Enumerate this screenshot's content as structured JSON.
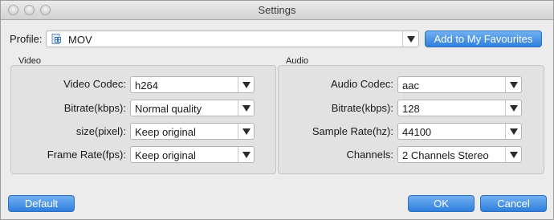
{
  "window": {
    "title": "Settings"
  },
  "profile": {
    "label": "Profile:",
    "value": "MOV",
    "favourites_label": "Add to My Favourites"
  },
  "video": {
    "title": "Video",
    "rows": [
      {
        "label": "Video Codec:",
        "value": "h264"
      },
      {
        "label": "Bitrate(kbps):",
        "value": "Normal quality"
      },
      {
        "label": "size(pixel):",
        "value": "Keep original"
      },
      {
        "label": "Frame Rate(fps):",
        "value": "Keep original"
      }
    ]
  },
  "audio": {
    "title": "Audio",
    "rows": [
      {
        "label": "Audio Codec:",
        "value": "aac"
      },
      {
        "label": "Bitrate(kbps):",
        "value": "128"
      },
      {
        "label": "Sample Rate(hz):",
        "value": "44100"
      },
      {
        "label": "Channels:",
        "value": "2 Channels Stereo"
      }
    ]
  },
  "buttons": {
    "default": "Default",
    "ok": "OK",
    "cancel": "Cancel"
  },
  "icons": {
    "profile": "film-file-icon",
    "dropdown": "chevron-down-icon"
  },
  "colors": {
    "accent_button": "#3d8be2",
    "window_bg": "#ececec",
    "panel_bg": "#e2e2e2"
  }
}
